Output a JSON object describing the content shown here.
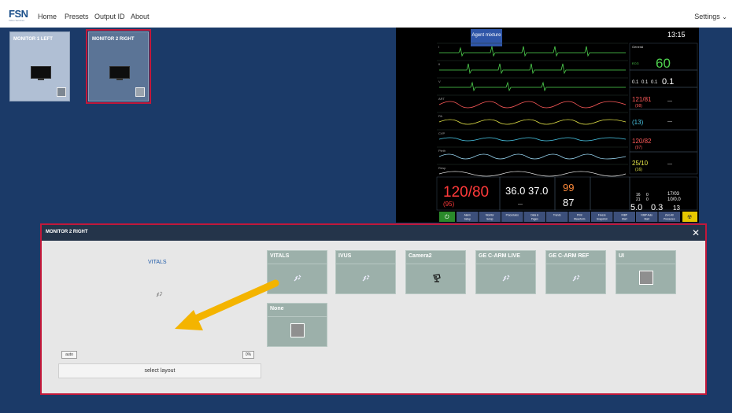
{
  "header": {
    "logo": "FSN",
    "logo_sub": "Video Services",
    "nav": [
      "Home",
      "Presets",
      "Output ID",
      "About"
    ],
    "settings_label": "Settings"
  },
  "monitors": [
    {
      "label": "MONITOR 1 LEFT",
      "layout_icon": "split-layout-icon",
      "selected": false
    },
    {
      "label": "MONITOR 2 RIGHT",
      "layout_icon": "single-layout-icon",
      "selected": true
    }
  ],
  "preview": {
    "agent_label": "Agent mixture",
    "time": "13:15",
    "general": "General",
    "hr": "60",
    "ecg": "ECG",
    "gas_values": [
      "0.1",
      "0.1",
      "0.1",
      "0.1"
    ],
    "art_side": "121/81",
    "art_side_mean": "(98)",
    "cvp_side": "(13)",
    "nbp_side": "120/82",
    "nbp_side_mean": "(97)",
    "pa_side": "25/10",
    "pa_side_mean": "(16)",
    "dashes": "---",
    "trace_labels": [
      "I",
      "II",
      "V",
      "ART",
      "PA",
      "CVP",
      "Pleth",
      "Resp"
    ],
    "art_big": "120/80",
    "art_big_mean": "(95)",
    "t1": "36.0",
    "t2": "37.0",
    "spo2": "99",
    "hr_bottom": "87",
    "bottom_vals": [
      "5.0",
      "0.3",
      "13"
    ],
    "small_vals": [
      "16",
      "21",
      "0",
      "0",
      "17/03",
      "10/0.0"
    ],
    "buttons": [
      "Alarm Setup",
      "Monitor Setup",
      "Procedures",
      "Data & Pages",
      "Trends",
      "Print Waveform",
      "Freeze Snapshot",
      "NIBP Start",
      "NIBP Auto Start",
      "Zero All Pressures"
    ]
  },
  "dialog": {
    "title": "MONITOR 2 RIGHT",
    "current_source": "VITALS",
    "auto_label": "auto",
    "percent_label": "0%",
    "select_layout_label": "select layout",
    "sources": [
      {
        "label": "VITALS",
        "icon": "link-broken-icon"
      },
      {
        "label": "IVUS",
        "icon": "link-broken-icon"
      },
      {
        "label": "Camera2",
        "icon": "camera-icon"
      },
      {
        "label": "GE C-ARM LIVE",
        "icon": "link-broken-icon"
      },
      {
        "label": "GE C-ARM REF",
        "icon": "link-broken-icon"
      },
      {
        "label": "UI",
        "icon": "square-icon"
      },
      {
        "label": "None",
        "icon": "square-icon"
      }
    ]
  },
  "colors": {
    "background": "#1b3a68",
    "selection": "#c2183a",
    "dialog_header": "#24344a",
    "tile": "#9cb0aa",
    "arrow": "#f4b400"
  }
}
